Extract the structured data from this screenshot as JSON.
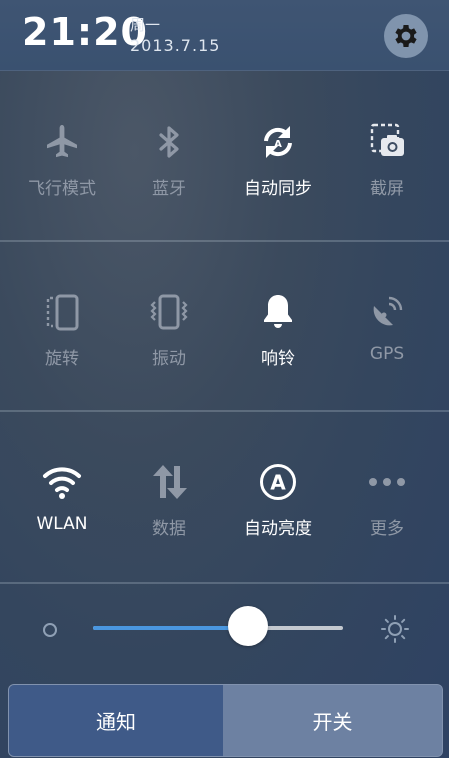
{
  "status": {
    "time": "21:20",
    "weekday": "周一",
    "date": "2013.7.15"
  },
  "toggles": [
    {
      "label": "飞行模式",
      "icon": "airplane-icon",
      "on": false
    },
    {
      "label": "蓝牙",
      "icon": "bluetooth-icon",
      "on": false
    },
    {
      "label": "自动同步",
      "icon": "sync-icon",
      "on": true
    },
    {
      "label": "截屏",
      "icon": "screenshot-icon",
      "on": false
    },
    {
      "label": "旋转",
      "icon": "rotate-icon",
      "on": false
    },
    {
      "label": "振动",
      "icon": "vibrate-icon",
      "on": false
    },
    {
      "label": "响铃",
      "icon": "bell-icon",
      "on": true
    },
    {
      "label": "GPS",
      "icon": "gps-icon",
      "on": false
    },
    {
      "label": "WLAN",
      "icon": "wifi-icon",
      "on": true
    },
    {
      "label": "数据",
      "icon": "data-icon",
      "on": false
    },
    {
      "label": "自动亮度",
      "icon": "auto-brightness-icon",
      "on": true
    },
    {
      "label": "更多",
      "icon": "more-icon",
      "on": false
    }
  ],
  "brightness": {
    "level_percent": 62
  },
  "tabs": {
    "notify": "通知",
    "switch": "开关"
  },
  "colors": {
    "active": "#ffffff",
    "inactive": "#8f98a6",
    "accent": "#4a97e0",
    "selected_tab": "#3f5a88"
  }
}
